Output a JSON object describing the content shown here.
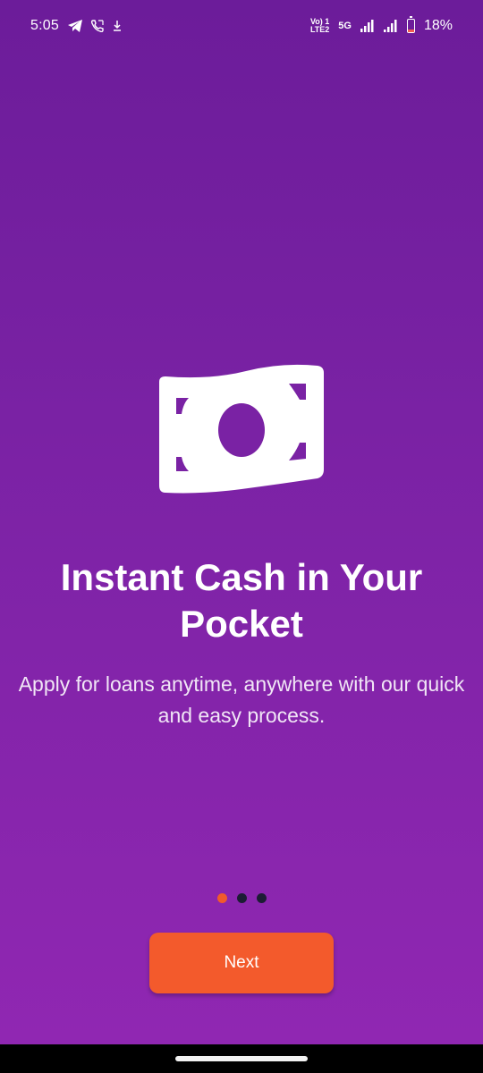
{
  "status_bar": {
    "time": "5:05",
    "left_icons": [
      "telegram-icon",
      "phone-call-icon",
      "download-icon"
    ],
    "network_label_top": "Vo) 1",
    "network_label_bottom": "LTE2",
    "network_type": "5G",
    "battery_percent": "18%",
    "battery_level": 0.18
  },
  "onboarding": {
    "illustration": "money-bill-icon",
    "title": "Instant Cash in Your Pocket",
    "subtitle": "Apply for loans anytime, anywhere with our quick and easy process.",
    "page_index": 1,
    "page_count": 3,
    "next_label": "Next"
  },
  "colors": {
    "accent": "#f35a2c",
    "background_top": "#6c1c9a",
    "background_bottom": "#9027b2",
    "dot_inactive": "#1c1d34"
  }
}
